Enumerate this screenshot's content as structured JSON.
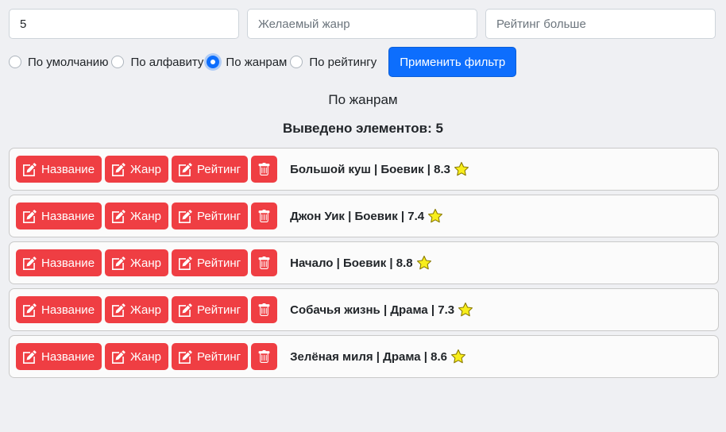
{
  "filters": {
    "count_value": "5",
    "genre_placeholder": "Желаемый жанр",
    "rating_placeholder": "Рейтинг больше"
  },
  "sort_options": [
    {
      "label": "По умолчанию",
      "checked": false
    },
    {
      "label": "По алфавиту",
      "checked": false
    },
    {
      "label": "По жанрам",
      "checked": true
    },
    {
      "label": "По рейтингу",
      "checked": false
    }
  ],
  "apply_label": "Применить фильтр",
  "sort_title": "По жанрам",
  "count_line": "Выведено элементов: 5",
  "buttons": {
    "name": "Название",
    "genre": "Жанр",
    "rating": "Рейтинг"
  },
  "icons": {
    "edit": "edit-icon",
    "delete": "trash-icon",
    "star": "star-icon"
  },
  "colors": {
    "accent": "#0d6efd",
    "danger": "#ef3e43",
    "star": "#f8ee1c"
  },
  "movies": [
    {
      "text": "Большой куш | Боевик | 8.3"
    },
    {
      "text": "Джон Уик | Боевик | 7.4"
    },
    {
      "text": "Начало | Боевик | 8.8"
    },
    {
      "text": "Собачья жизнь | Драма | 7.3"
    },
    {
      "text": "Зелёная миля | Драма | 8.6"
    }
  ]
}
